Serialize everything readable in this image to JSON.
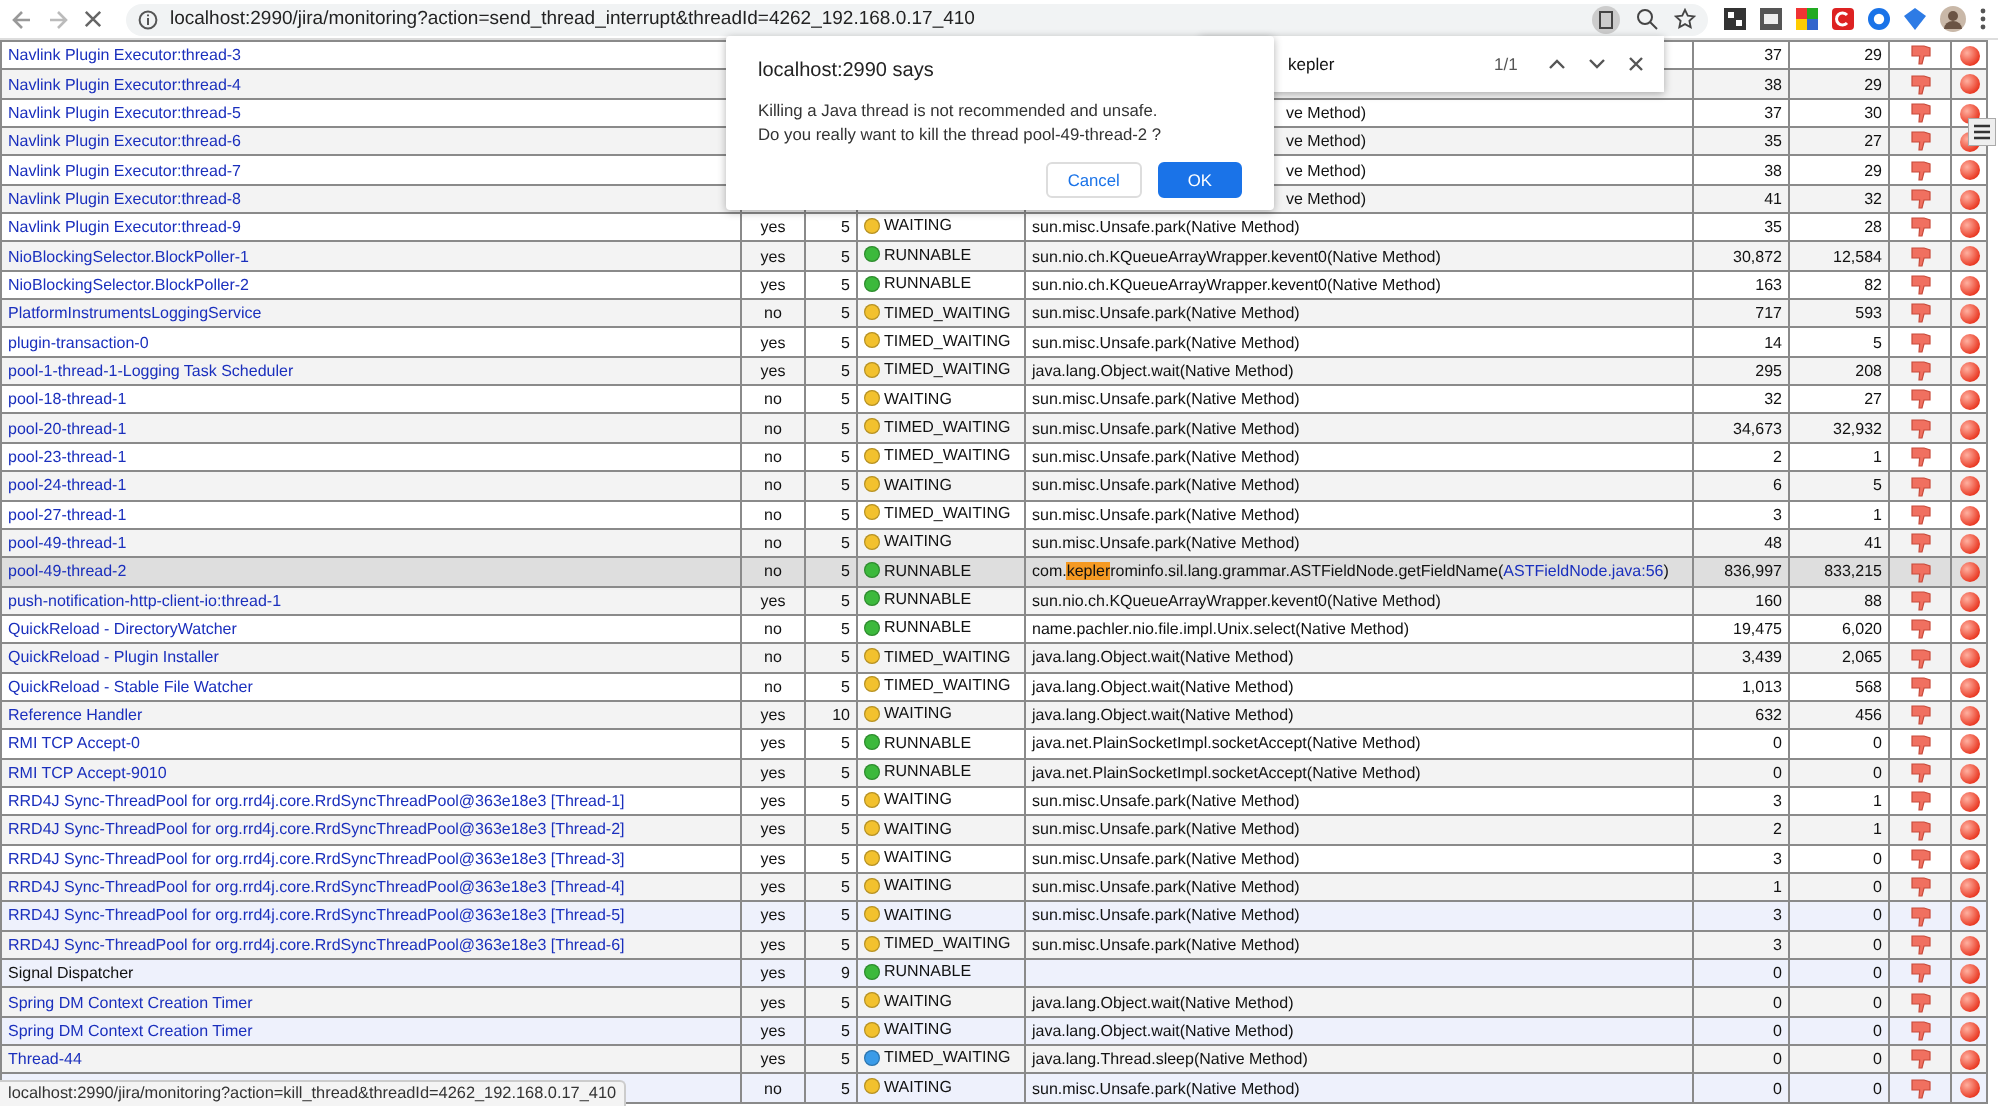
{
  "browser": {
    "url": "localhost:2990/jira/monitoring?action=send_thread_interrupt&threadId=4262_192.168.0.17_410"
  },
  "find_bar": {
    "query": "kepler",
    "count": "1/1"
  },
  "dialog": {
    "title": "localhost:2990 says",
    "lines": [
      "Killing a Java thread is not recommended and unsafe.",
      "Do you really want to kill the thread pool-49-thread-2 ?"
    ],
    "buttons": [
      {
        "label": "Cancel",
        "kind": "secondary"
      },
      {
        "label": "OK",
        "kind": "primary"
      }
    ]
  },
  "threads": [
    {
      "name": "Navlink Plugin Executor:thread-3",
      "covered": true,
      "cpu": "37",
      "user": "29",
      "selected": false,
      "tinted": false,
      "link": true
    },
    {
      "name": "Navlink Plugin Executor:thread-4",
      "covered": true,
      "cpu": "38",
      "user": "29",
      "selected": false,
      "tinted": false,
      "link": true
    },
    {
      "name": "Navlink Plugin Executor:thread-5",
      "covered": true,
      "method": "ve Method)",
      "cpu": "37",
      "user": "30",
      "selected": false,
      "tinted": false,
      "link": true
    },
    {
      "name": "Navlink Plugin Executor:thread-6",
      "covered": true,
      "method": "ve Method)",
      "cpu": "35",
      "user": "27",
      "selected": false,
      "tinted": false,
      "link": true
    },
    {
      "name": "Navlink Plugin Executor:thread-7",
      "covered": true,
      "method": "ve Method)",
      "cpu": "38",
      "user": "29",
      "selected": false,
      "tinted": false,
      "link": true
    },
    {
      "name": "Navlink Plugin Executor:thread-8",
      "covered": true,
      "method": "ve Method)",
      "cpu": "41",
      "user": "32",
      "selected": false,
      "tinted": false,
      "link": true
    },
    {
      "name": "Navlink Plugin Executor:thread-9",
      "daemon": "yes",
      "priority": "5",
      "state": "WAITING",
      "color": "#f2c12e",
      "method": "sun.misc.Unsafe.park(Native Method)",
      "cpu": "35",
      "user": "28",
      "selected": false,
      "tinted": false,
      "link": true
    },
    {
      "name": "NioBlockingSelector.BlockPoller-1",
      "daemon": "yes",
      "priority": "5",
      "state": "RUNNABLE",
      "color": "#3cb93c",
      "method": "sun.nio.ch.KQueueArrayWrapper.kevent0(Native Method)",
      "cpu": "30,872",
      "user": "12,584",
      "selected": false,
      "tinted": false,
      "link": true
    },
    {
      "name": "NioBlockingSelector.BlockPoller-2",
      "daemon": "yes",
      "priority": "5",
      "state": "RUNNABLE",
      "color": "#3cb93c",
      "method": "sun.nio.ch.KQueueArrayWrapper.kevent0(Native Method)",
      "cpu": "163",
      "user": "82",
      "selected": false,
      "tinted": false,
      "link": true
    },
    {
      "name": "PlatformInstrumentsLoggingService",
      "daemon": "no",
      "priority": "5",
      "state": "TIMED_WAITING",
      "color": "#f2c12e",
      "method": "sun.misc.Unsafe.park(Native Method)",
      "cpu": "717",
      "user": "593",
      "selected": false,
      "tinted": false,
      "link": true
    },
    {
      "name": "plugin-transaction-0",
      "daemon": "yes",
      "priority": "5",
      "state": "TIMED_WAITING",
      "color": "#f2c12e",
      "method": "sun.misc.Unsafe.park(Native Method)",
      "cpu": "14",
      "user": "5",
      "selected": false,
      "tinted": false,
      "link": true
    },
    {
      "name": "pool-1-thread-1-Logging Task Scheduler",
      "daemon": "yes",
      "priority": "5",
      "state": "TIMED_WAITING",
      "color": "#f2c12e",
      "method": "java.lang.Object.wait(Native Method)",
      "cpu": "295",
      "user": "208",
      "selected": false,
      "tinted": false,
      "link": true
    },
    {
      "name": "pool-18-thread-1",
      "daemon": "no",
      "priority": "5",
      "state": "WAITING",
      "color": "#f2c12e",
      "method": "sun.misc.Unsafe.park(Native Method)",
      "cpu": "32",
      "user": "27",
      "selected": false,
      "tinted": false,
      "link": true
    },
    {
      "name": "pool-20-thread-1",
      "daemon": "no",
      "priority": "5",
      "state": "TIMED_WAITING",
      "color": "#f2c12e",
      "method": "sun.misc.Unsafe.park(Native Method)",
      "cpu": "34,673",
      "user": "32,932",
      "selected": false,
      "tinted": false,
      "link": true
    },
    {
      "name": "pool-23-thread-1",
      "daemon": "no",
      "priority": "5",
      "state": "TIMED_WAITING",
      "color": "#f2c12e",
      "method": "sun.misc.Unsafe.park(Native Method)",
      "cpu": "2",
      "user": "1",
      "selected": false,
      "tinted": false,
      "link": true
    },
    {
      "name": "pool-24-thread-1",
      "daemon": "no",
      "priority": "5",
      "state": "WAITING",
      "color": "#f2c12e",
      "method": "sun.misc.Unsafe.park(Native Method)",
      "cpu": "6",
      "user": "5",
      "selected": false,
      "tinted": false,
      "link": true
    },
    {
      "name": "pool-27-thread-1",
      "daemon": "no",
      "priority": "5",
      "state": "TIMED_WAITING",
      "color": "#f2c12e",
      "method": "sun.misc.Unsafe.park(Native Method)",
      "cpu": "3",
      "user": "1",
      "selected": false,
      "tinted": false,
      "link": true
    },
    {
      "name": "pool-49-thread-1",
      "daemon": "no",
      "priority": "5",
      "state": "WAITING",
      "color": "#f2c12e",
      "method": "sun.misc.Unsafe.park(Native Method)",
      "cpu": "48",
      "user": "41",
      "selected": false,
      "tinted": false,
      "link": true
    },
    {
      "name": "pool-49-thread-2",
      "daemon": "no",
      "priority": "5",
      "state": "RUNNABLE",
      "color": "#3cb93c",
      "method_segments": [
        {
          "kind": "text",
          "text": "com."
        },
        {
          "kind": "match",
          "text": "kepler"
        },
        {
          "kind": "text",
          "text": "rominfo.sil.lang.grammar.ASTFieldNode.getFieldName("
        },
        {
          "kind": "link",
          "text": "ASTFieldNode.java:56"
        },
        {
          "kind": "text",
          "text": ")"
        }
      ],
      "cpu": "836,997",
      "user": "833,215",
      "selected": true,
      "tinted": false,
      "link": true
    },
    {
      "name": "push-notification-http-client-io:thread-1",
      "daemon": "yes",
      "priority": "5",
      "state": "RUNNABLE",
      "color": "#3cb93c",
      "method": "sun.nio.ch.KQueueArrayWrapper.kevent0(Native Method)",
      "cpu": "160",
      "user": "88",
      "selected": false,
      "tinted": false,
      "link": true
    },
    {
      "name": "QuickReload - DirectoryWatcher",
      "daemon": "no",
      "priority": "5",
      "state": "RUNNABLE",
      "color": "#3cb93c",
      "method": "name.pachler.nio.file.impl.Unix.select(Native Method)",
      "cpu": "19,475",
      "user": "6,020",
      "selected": false,
      "tinted": false,
      "link": true
    },
    {
      "name": "QuickReload - Plugin Installer",
      "daemon": "no",
      "priority": "5",
      "state": "TIMED_WAITING",
      "color": "#f2c12e",
      "method": "java.lang.Object.wait(Native Method)",
      "cpu": "3,439",
      "user": "2,065",
      "selected": false,
      "tinted": false,
      "link": true
    },
    {
      "name": "QuickReload - Stable File Watcher",
      "daemon": "no",
      "priority": "5",
      "state": "TIMED_WAITING",
      "color": "#f2c12e",
      "method": "java.lang.Object.wait(Native Method)",
      "cpu": "1,013",
      "user": "568",
      "selected": false,
      "tinted": false,
      "link": true
    },
    {
      "name": "Reference Handler",
      "daemon": "yes",
      "priority": "10",
      "state": "WAITING",
      "color": "#f2c12e",
      "method": "java.lang.Object.wait(Native Method)",
      "cpu": "632",
      "user": "456",
      "selected": false,
      "tinted": false,
      "link": true
    },
    {
      "name": "RMI TCP Accept-0",
      "daemon": "yes",
      "priority": "5",
      "state": "RUNNABLE",
      "color": "#3cb93c",
      "method": "java.net.PlainSocketImpl.socketAccept(Native Method)",
      "cpu": "0",
      "user": "0",
      "selected": false,
      "tinted": false,
      "link": true
    },
    {
      "name": "RMI TCP Accept-9010",
      "daemon": "yes",
      "priority": "5",
      "state": "RUNNABLE",
      "color": "#3cb93c",
      "method": "java.net.PlainSocketImpl.socketAccept(Native Method)",
      "cpu": "0",
      "user": "0",
      "selected": false,
      "tinted": false,
      "link": true
    },
    {
      "name": "RRD4J Sync-ThreadPool for org.rrd4j.core.RrdSyncThreadPool@363e18e3 [Thread-1]",
      "daemon": "yes",
      "priority": "5",
      "state": "WAITING",
      "color": "#f2c12e",
      "method": "sun.misc.Unsafe.park(Native Method)",
      "cpu": "3",
      "user": "1",
      "selected": false,
      "tinted": false,
      "link": true
    },
    {
      "name": "RRD4J Sync-ThreadPool for org.rrd4j.core.RrdSyncThreadPool@363e18e3 [Thread-2]",
      "daemon": "yes",
      "priority": "5",
      "state": "WAITING",
      "color": "#f2c12e",
      "method": "sun.misc.Unsafe.park(Native Method)",
      "cpu": "2",
      "user": "1",
      "selected": false,
      "tinted": false,
      "link": true
    },
    {
      "name": "RRD4J Sync-ThreadPool for org.rrd4j.core.RrdSyncThreadPool@363e18e3 [Thread-3]",
      "daemon": "yes",
      "priority": "5",
      "state": "WAITING",
      "color": "#f2c12e",
      "method": "sun.misc.Unsafe.park(Native Method)",
      "cpu": "3",
      "user": "0",
      "selected": false,
      "tinted": false,
      "link": true
    },
    {
      "name": "RRD4J Sync-ThreadPool for org.rrd4j.core.RrdSyncThreadPool@363e18e3 [Thread-4]",
      "daemon": "yes",
      "priority": "5",
      "state": "WAITING",
      "color": "#f2c12e",
      "method": "sun.misc.Unsafe.park(Native Method)",
      "cpu": "1",
      "user": "0",
      "selected": false,
      "tinted": false,
      "link": true
    },
    {
      "name": "RRD4J Sync-ThreadPool for org.rrd4j.core.RrdSyncThreadPool@363e18e3 [Thread-5]",
      "daemon": "yes",
      "priority": "5",
      "state": "WAITING",
      "color": "#f2c12e",
      "method": "sun.misc.Unsafe.park(Native Method)",
      "cpu": "3",
      "user": "0",
      "selected": false,
      "tinted": true,
      "link": true
    },
    {
      "name": "RRD4J Sync-ThreadPool for org.rrd4j.core.RrdSyncThreadPool@363e18e3 [Thread-6]",
      "daemon": "yes",
      "priority": "5",
      "state": "TIMED_WAITING",
      "color": "#f2c12e",
      "method": "sun.misc.Unsafe.park(Native Method)",
      "cpu": "3",
      "user": "0",
      "selected": false,
      "tinted": false,
      "link": true
    },
    {
      "name": "Signal Dispatcher",
      "daemon": "yes",
      "priority": "9",
      "state": "RUNNABLE",
      "color": "#3cb93c",
      "cpu": "0",
      "user": "0",
      "selected": false,
      "tinted": true,
      "link": false
    },
    {
      "name": "Spring DM Context Creation Timer",
      "daemon": "yes",
      "priority": "5",
      "state": "WAITING",
      "color": "#f2c12e",
      "method": "java.lang.Object.wait(Native Method)",
      "cpu": "0",
      "user": "0",
      "selected": false,
      "tinted": false,
      "link": true
    },
    {
      "name": "Spring DM Context Creation Timer",
      "daemon": "yes",
      "priority": "5",
      "state": "WAITING",
      "color": "#f2c12e",
      "method": "java.lang.Object.wait(Native Method)",
      "cpu": "0",
      "user": "0",
      "selected": false,
      "tinted": true,
      "link": true
    },
    {
      "name": "Thread-44",
      "daemon": "yes",
      "priority": "5",
      "state": "TIMED_WAITING",
      "color": "#3a9be8",
      "method": "java.lang.Thread.sleep(Native Method)",
      "cpu": "0",
      "user": "0",
      "selected": false,
      "tinted": false,
      "link": true
    },
    {
      "daemon": "no",
      "priority": "5",
      "state": "WAITING",
      "color": "#f2c12e",
      "method": "sun.misc.Unsafe.park(Native Method)",
      "cpu": "0",
      "user": "0",
      "selected": false,
      "tinted": true
    }
  ],
  "status_bar": "localhost:2990/jira/monitoring?action=kill_thread&threadId=4262_192.168.0.17_410"
}
